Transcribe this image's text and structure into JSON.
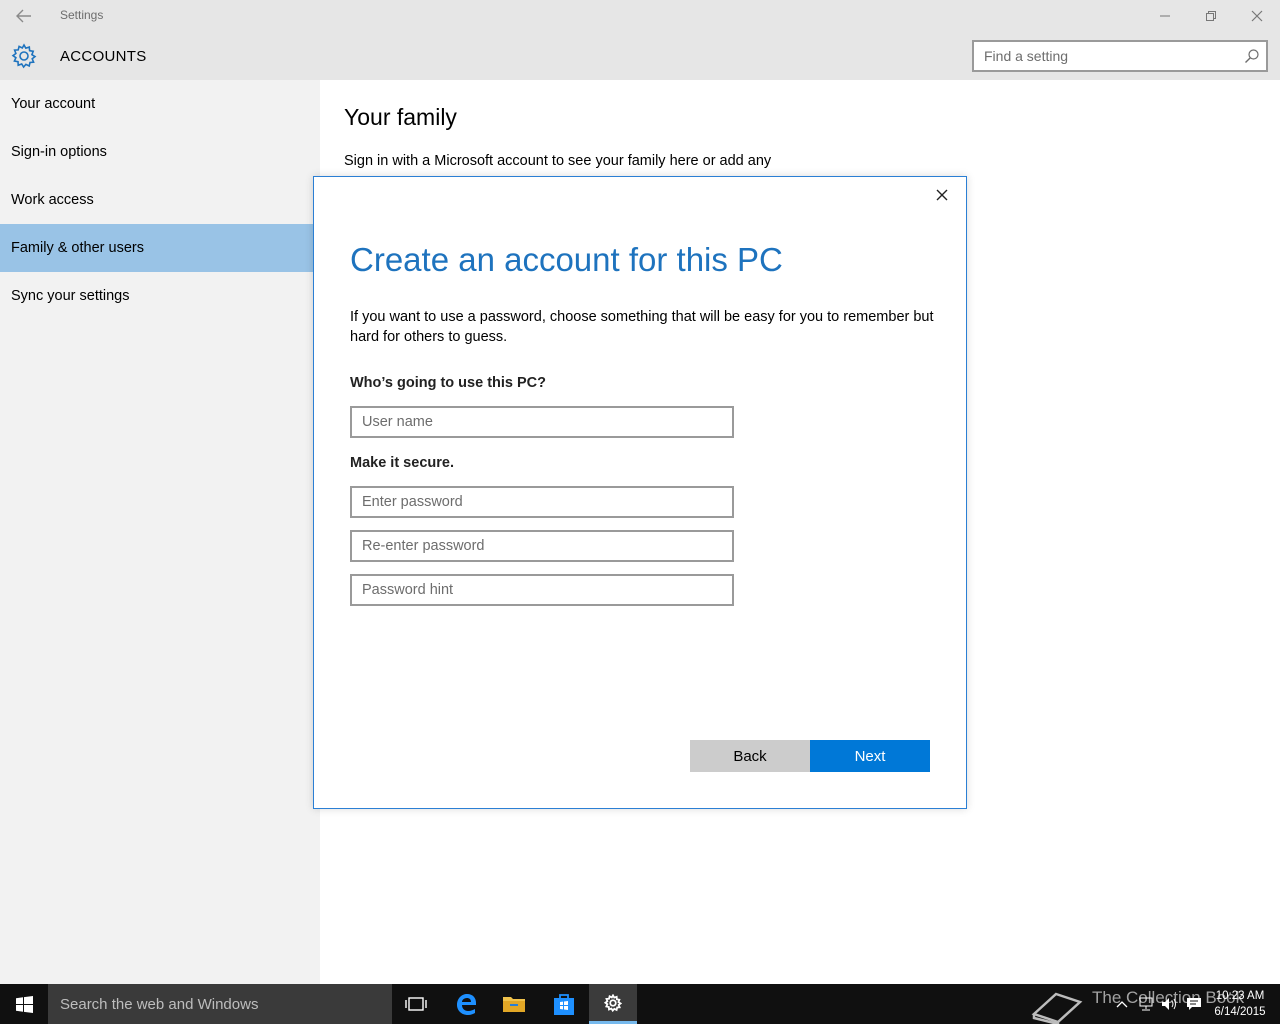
{
  "window": {
    "title": "Settings",
    "minimize": "—",
    "maximize": "❐",
    "close": "✕"
  },
  "header": {
    "section": "ACCOUNTS",
    "search_placeholder": "Find a setting"
  },
  "sidebar": {
    "items": [
      {
        "label": "Your account"
      },
      {
        "label": "Sign-in options"
      },
      {
        "label": "Work access"
      },
      {
        "label": "Family & other users",
        "active": true
      },
      {
        "label": "Sync your settings"
      }
    ]
  },
  "main": {
    "title": "Your family",
    "text": "Sign in with a Microsoft account to see your family here or add any"
  },
  "dialog": {
    "title": "Create an account for this PC",
    "description": "If you want to use a password, choose something that will be easy for you to remember but hard for others to guess.",
    "who_label": "Who’s going to use this PC?",
    "username_placeholder": "User name",
    "secure_label": "Make it secure.",
    "password_placeholder": "Enter password",
    "reenter_placeholder": "Re-enter password",
    "hint_placeholder": "Password hint",
    "back_label": "Back",
    "next_label": "Next",
    "close_glyph": "✕"
  },
  "taskbar": {
    "search_text": "Search the web and Windows",
    "time": "10:23 AM",
    "date": "6/14/2015",
    "watermark": "The Collection Book"
  },
  "colors": {
    "accent": "#0078d7",
    "dialog_title": "#1e73be",
    "sidebar_active": "#99c3e6"
  }
}
